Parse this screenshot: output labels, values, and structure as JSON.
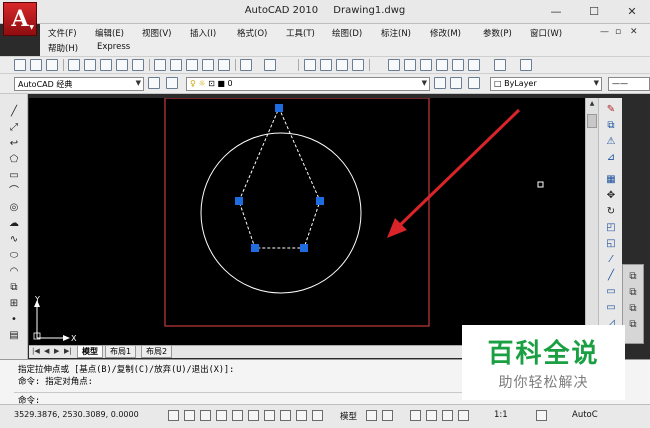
{
  "title": {
    "app": "AutoCAD 2010",
    "document": "Drawing1.dwg"
  },
  "window_controls": {
    "minimize": "—",
    "maximize": "☐",
    "close": "✕"
  },
  "menu": {
    "row1": [
      "文件(F)",
      "编辑(E)",
      "视图(V)",
      "插入(I)",
      "格式(O)",
      "工具(T)",
      "绘图(D)",
      "标注(N)",
      "修改(M)",
      "参数(P)",
      "窗口(W)"
    ],
    "row2": [
      "帮助(H)",
      "Express"
    ]
  },
  "toolbar2": {
    "workspace": "AutoCAD 经典",
    "layer": "0",
    "linetype": "ByLayer"
  },
  "layout_tabs": [
    "模型",
    "布局1",
    "布局2"
  ],
  "command": {
    "line1": "指定拉伸点或 [基点(B)/复制(C)/放弃(U)/退出(X)]:",
    "line2": "命令: 指定对角点:",
    "prompt": "命令:"
  },
  "status": {
    "coords": "3529.3876,  2530.3089, 0.0000",
    "model": "模型",
    "scale": "1:1",
    "autocad": "AutoC"
  },
  "ucs": {
    "x_label": "X",
    "y_label": "Y"
  },
  "watermark": {
    "title": "百科全说",
    "subtitle": "助你轻松解决"
  },
  "colors": {
    "canvas": "#000000",
    "grip": "#1e6de0",
    "circle": "#ffffff",
    "arrow": "#d9252a",
    "viewport": "#c33a3a",
    "watermark": "#1aa043"
  }
}
